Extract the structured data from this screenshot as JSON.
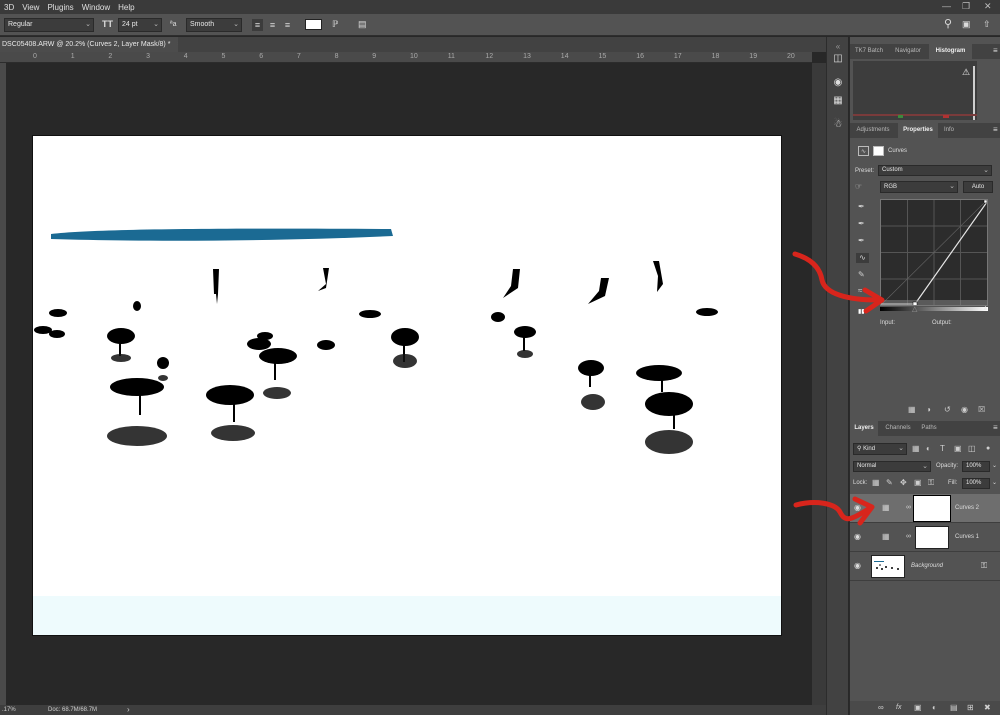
{
  "menubar": {
    "items": [
      "3D",
      "View",
      "Plugins",
      "Window",
      "Help"
    ],
    "controls": [
      "—",
      "❐",
      "✕"
    ]
  },
  "options": {
    "font_style": "Regular",
    "font_size": "24 pt",
    "aa_label": "ªa",
    "antialias": "Smooth"
  },
  "document": {
    "tab_title": "DSC05408.ARW @ 20.2% (Curves 2, Layer Mask/8) *",
    "close": "×"
  },
  "ruler": {
    "h_labels": [
      "0",
      "1",
      "2",
      "3",
      "4",
      "5",
      "6",
      "7",
      "8",
      "9",
      "10",
      "11",
      "12",
      "13",
      "14",
      "15",
      "16",
      "17",
      "18",
      "19",
      "20"
    ]
  },
  "status": {
    "zoom": ".17%",
    "doc": "Doc: 68.7M/68.7M",
    "arrow": "›"
  },
  "panels": {
    "top_tabs": [
      "TK7 Batch",
      "Navigator",
      "Histogram"
    ],
    "warning": "⚠",
    "mid_tabs": [
      "Adjustments",
      "Properties",
      "Info"
    ],
    "properties": {
      "title": "Curves",
      "preset_label": "Preset:",
      "preset_value": "Custom",
      "channel": "RGB",
      "auto": "Auto",
      "input_label": "Input:",
      "output_label": "Output:"
    },
    "layers_tabs": [
      "Layers",
      "Channels",
      "Paths"
    ],
    "layers": {
      "filter_kind": "Kind",
      "blend_mode": "Normal",
      "opacity_label": "Opacity:",
      "opacity_value": "100%",
      "lock_label": "Lock:",
      "fill_label": "Fill:",
      "fill_value": "100%",
      "items": [
        {
          "name": "Curves 2"
        },
        {
          "name": "Curves 1"
        },
        {
          "name": "Background"
        }
      ],
      "bottom_icons": [
        "∞",
        "fx",
        "▣",
        "◐",
        "▤",
        "⊞",
        "✖"
      ]
    }
  },
  "colors": {
    "annotation_red": "#d8251c",
    "stroke_blue": "#1b6a93",
    "panel_bg": "#535353",
    "workspace_bg": "#282828"
  }
}
